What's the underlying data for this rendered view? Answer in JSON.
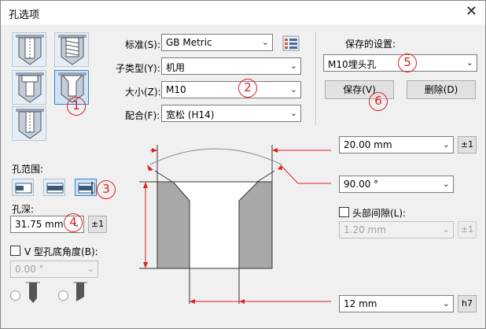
{
  "window": {
    "title": "孔选项",
    "close_glyph": "✕"
  },
  "standard": {
    "label": "标准(S):",
    "value": "GB Metric"
  },
  "subtype": {
    "label": "子类型(Y):",
    "value": "机用"
  },
  "size": {
    "label": "大小(Z):",
    "value": "M10"
  },
  "fit": {
    "label": "配合(F):",
    "value": "宽松 (H14)"
  },
  "saved": {
    "label": "保存的设置:",
    "value": "M10埋头孔",
    "save": "保存(V)",
    "delete": "删除(D)"
  },
  "hole_range": {
    "label": "孔范围:"
  },
  "hole_depth": {
    "label": "孔深:",
    "value": "31.75 mm",
    "tol": "±1"
  },
  "v_angle": {
    "label": "V 型孔底角度(B):",
    "value": "0.00 °"
  },
  "diam1": {
    "value": "20.00 mm",
    "tol": "±1"
  },
  "angle": {
    "value": "90.00 °"
  },
  "head_clearance": {
    "label": "头部间隙(L):",
    "value": "1.20 mm",
    "tol": "±1"
  },
  "bottom_diam": {
    "value": "12 mm",
    "tol": "h7"
  },
  "callouts": [
    "1",
    "2",
    "3",
    "4",
    "5",
    "6"
  ]
}
